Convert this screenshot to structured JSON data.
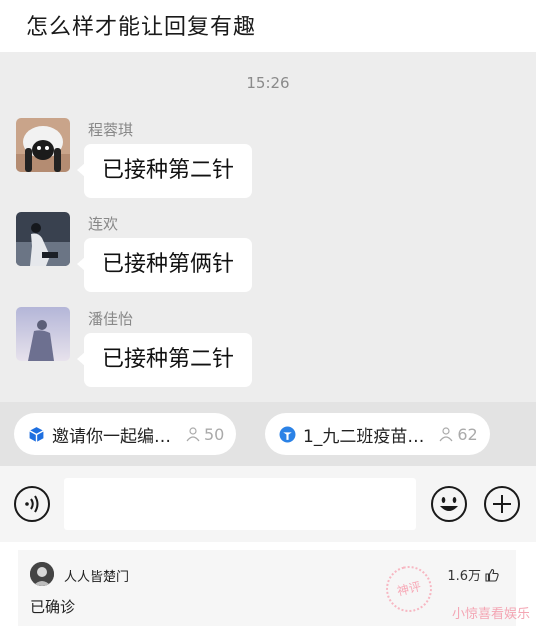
{
  "post": {
    "title": "怎么样才能让回复有趣"
  },
  "chat": {
    "time": "15:26",
    "messages": [
      {
        "sender": "程蓉琪",
        "text": "已接种第二针"
      },
      {
        "sender": "连欢",
        "text": "已接种第俩针"
      },
      {
        "sender": "潘佳怡",
        "text": "已接种第二针"
      }
    ]
  },
  "groups": [
    {
      "name": "邀请你一起编…",
      "count": "50",
      "icon": "cube-icon",
      "color": "#1e6fe0"
    },
    {
      "name": "1_九二班疫苗…",
      "count": "62",
      "icon": "group-logo-icon",
      "color": "#2b82e6"
    }
  ],
  "input_bar": {
    "voice_icon": "voice-icon",
    "emoji_icon": "emoji-icon",
    "plus_icon": "plus-icon",
    "placeholder": ""
  },
  "comment": {
    "user": "人人皆楚门",
    "likes": "1.6万",
    "text": "已确诊"
  },
  "overlay": {
    "stamp": "神评",
    "watermark": "小惊喜看娱乐"
  }
}
